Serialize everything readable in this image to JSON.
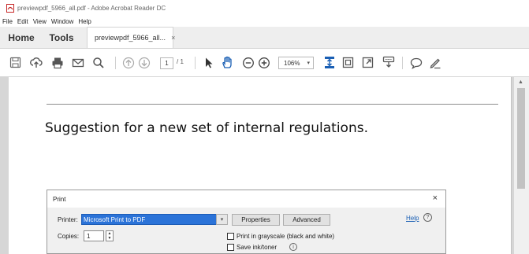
{
  "window": {
    "title": "previewpdf_5966_all.pdf - Adobe Acrobat Reader DC"
  },
  "menu": {
    "items": [
      "File",
      "Edit",
      "View",
      "Window",
      "Help"
    ]
  },
  "tabs": {
    "home": "Home",
    "tools": "Tools",
    "document": "previewpdf_5966_all...",
    "close": "×"
  },
  "toolbar": {
    "page_number": "1",
    "page_total": "/ 1",
    "zoom": "106%",
    "icons": [
      "save-icon",
      "upload-icon",
      "print-icon",
      "email-icon",
      "search-icon",
      "previous-page-icon",
      "next-page-icon",
      "select-cursor-icon",
      "hand-tool-icon",
      "zoom-out-icon",
      "zoom-in-icon",
      "fit-page-icon",
      "full-screen-icon",
      "marquee-zoom-icon",
      "stamp-icon",
      "comment-icon",
      "sign-icon"
    ]
  },
  "document": {
    "heading": "Suggestion for a new set of internal regulations."
  },
  "print_dialog": {
    "title": "Print",
    "close": "×",
    "printer_label": "Printer:",
    "printer_value": "Microsoft Print to PDF",
    "properties_button": "Properties",
    "advanced_button": "Advanced",
    "help_link": "Help",
    "copies_label": "Copies:",
    "copies_value": "1",
    "grayscale_label": "Print in grayscale (black and white)",
    "save_ink_label": "Save ink/toner"
  }
}
